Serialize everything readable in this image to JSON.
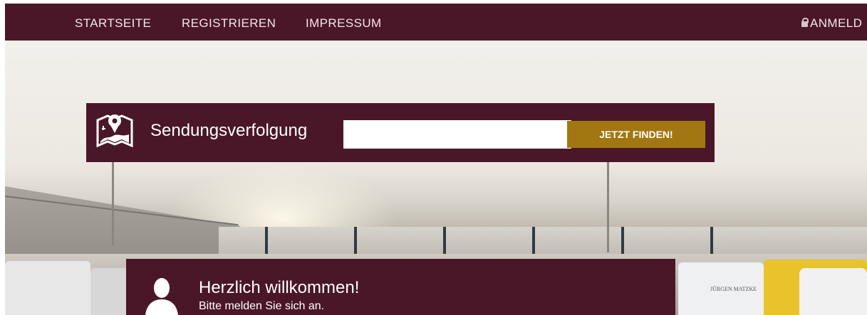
{
  "nav": {
    "home": "STARTSEITE",
    "register": "REGISTRIEREN",
    "imprint": "IMPRESSUM",
    "login": "ANMELD"
  },
  "tracking": {
    "title": "Sendungsverfolgung",
    "input_value": "",
    "button_label": "JETZT FINDEN!",
    "icon": "map-pin-icon"
  },
  "welcome": {
    "title": "Herzlich willkommen!",
    "subtitle": "Bitte melden Sie sich an.",
    "icon": "user-silhouette-icon"
  },
  "hero": {
    "truck_brand": "JÜRGEN MATZKE"
  },
  "colors": {
    "primary": "#4a1728",
    "accent": "#a27711",
    "text_light": "#ffffff"
  }
}
